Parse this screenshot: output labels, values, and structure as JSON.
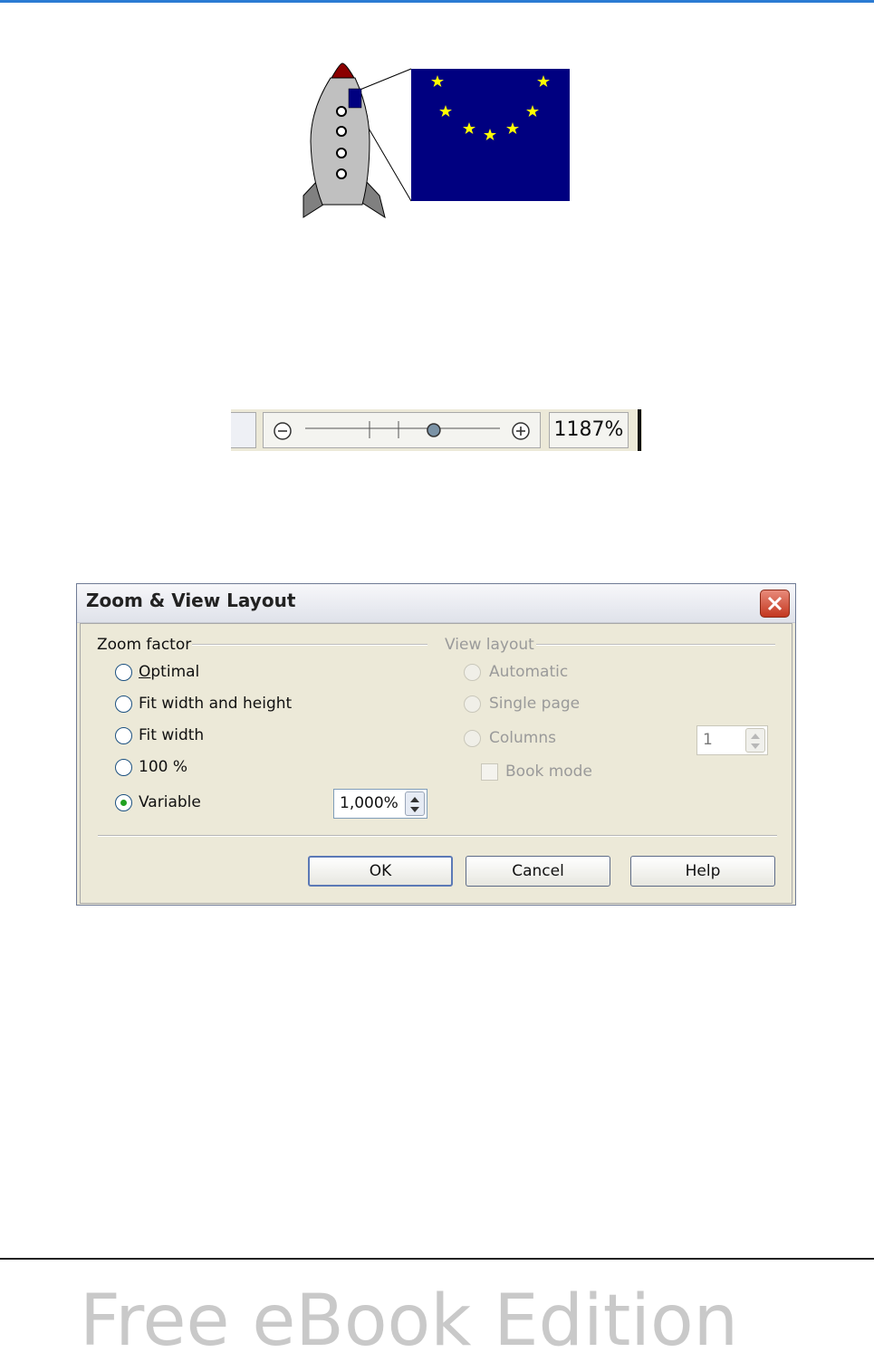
{
  "dialog": {
    "title": "Zoom & View Layout",
    "zoom_factor": {
      "group_label": "Zoom factor",
      "options": [
        "Optimal",
        "Fit width and height",
        "Fit width",
        "100 %",
        "Variable"
      ],
      "selected": "Variable",
      "variable_value": "1,000%"
    },
    "view_layout": {
      "group_label": "View layout",
      "options": [
        "Automatic",
        "Single page",
        "Columns"
      ],
      "columns_value": "1",
      "book_mode_label": "Book mode",
      "enabled": false
    },
    "buttons": {
      "ok": "OK",
      "cancel": "Cancel",
      "help": "Help"
    }
  },
  "zoombar": {
    "zoom_percent": "1187%",
    "slider_position": 0.66
  },
  "footer": {
    "text": "Free eBook Edition"
  },
  "colors": {
    "accent_rule": "#2b7bd3",
    "flag_blue": "#000080",
    "star_yellow": "#ffff00",
    "rocket_nose": "#8b0000"
  }
}
